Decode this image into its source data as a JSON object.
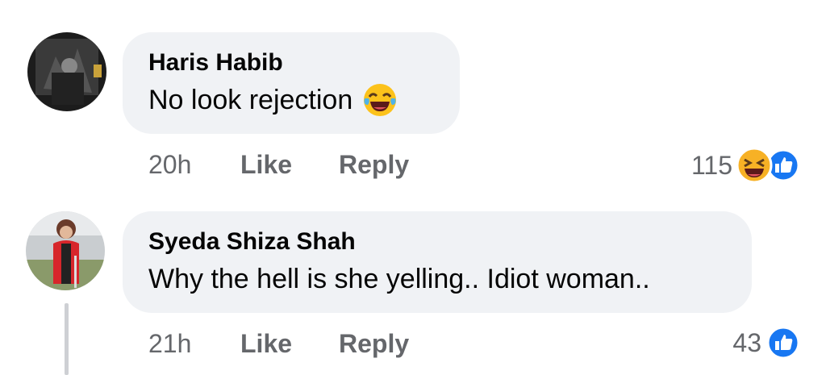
{
  "comments": [
    {
      "author": "Haris Habib",
      "text": "No look rejection",
      "emoji": "laughing-crying-emoji",
      "time": "20h",
      "like_label": "Like",
      "reply_label": "Reply",
      "reaction_count": "115",
      "reactions": [
        "haha",
        "like"
      ]
    },
    {
      "author": "Syeda Shiza Shah",
      "text": "Why the hell is she yelling.. Idiot woman..",
      "time": "21h",
      "like_label": "Like",
      "reply_label": "Reply",
      "reaction_count": "43",
      "reactions": [
        "like"
      ]
    }
  ],
  "colors": {
    "bubble": "#f0f2f5",
    "meta_text": "#65676b",
    "like_blue": "#1877f2",
    "haha_yellow": "#f7b125"
  }
}
